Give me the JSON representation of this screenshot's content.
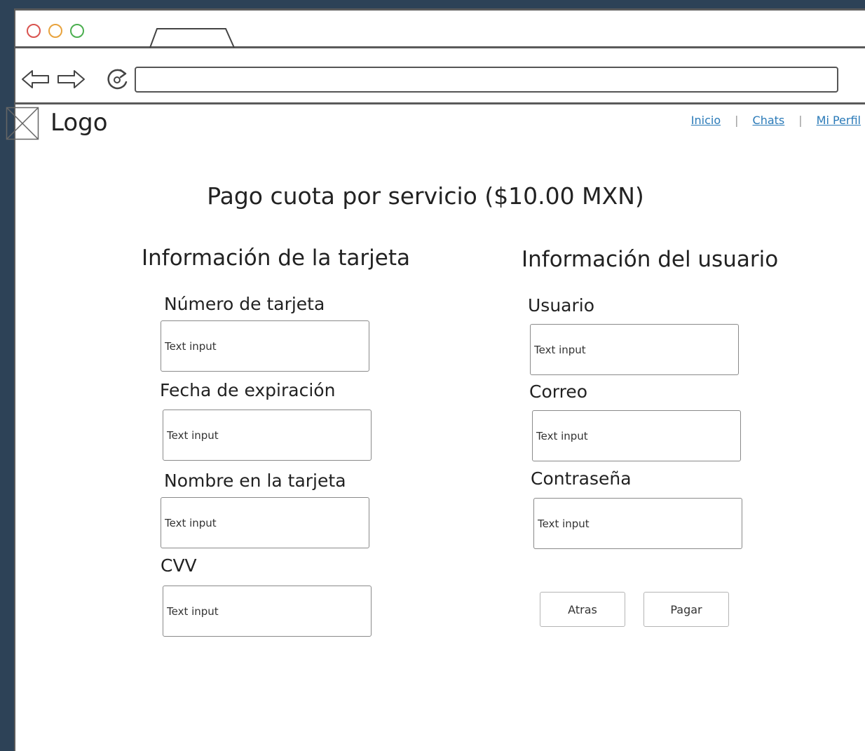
{
  "header": {
    "logo_text": "Logo",
    "links": [
      "Inicio",
      "Chats",
      "Mi Perfil"
    ]
  },
  "main": {
    "title": "Pago cuota por servicio ($10.00 MXN)",
    "card_section": {
      "title": "Información de la tarjeta",
      "fields": [
        {
          "label": "Número de tarjeta",
          "placeholder": "Text input"
        },
        {
          "label": "Fecha de expiración",
          "placeholder": "Text input"
        },
        {
          "label": "Nombre en la tarjeta",
          "placeholder": "Text input"
        },
        {
          "label": "CVV",
          "placeholder": "Text input"
        }
      ]
    },
    "user_section": {
      "title": "Información del usuario",
      "fields": [
        {
          "label": "Usuario",
          "placeholder": "Text input"
        },
        {
          "label": "Correo",
          "placeholder": "Text input"
        },
        {
          "label": "Contraseña",
          "placeholder": "Text input"
        }
      ]
    },
    "buttons": {
      "back": "Atras",
      "pay": "Pagar"
    }
  },
  "icons": {
    "browser_close": "circle-red-icon",
    "browser_minimize": "circle-yellow-icon",
    "browser_maximize": "circle-green-icon",
    "back": "arrow-left-icon",
    "forward": "arrow-right-icon",
    "reload": "reload-icon",
    "logo": "image-placeholder-icon"
  },
  "colors": {
    "background": "#2d4257",
    "link": "#2a7ab8",
    "dot_red": "#d9534f",
    "dot_yellow": "#e8a33d",
    "dot_green": "#4caf50"
  }
}
